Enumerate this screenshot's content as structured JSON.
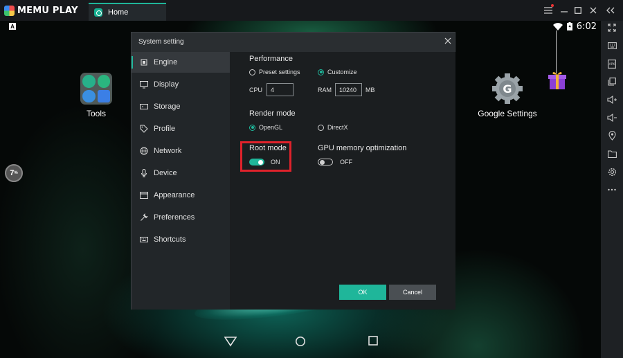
{
  "app": {
    "brand": "MEMU PLAY",
    "accent_color": "#1fb69a"
  },
  "tabs": [
    {
      "label": "Home",
      "icon": "home-app-icon"
    }
  ],
  "window_controls": [
    "menu-icon",
    "minimize-icon",
    "maximize-icon",
    "close-icon",
    "collapse-sidebar-icon"
  ],
  "right_sidebar": {
    "icons": [
      "fullscreen-icon",
      "keyboard-icon",
      "apk-icon",
      "multi-window-icon",
      "volume-up-icon",
      "volume-down-icon",
      "location-icon",
      "folder-icon",
      "settings-icon",
      "more-icon"
    ],
    "apk_text": "APK"
  },
  "android": {
    "status": {
      "time": "6:02",
      "notification_letter": "A"
    },
    "desktop": [
      {
        "label": "Tools",
        "icon": "tools-folder-icon"
      },
      {
        "label": "Google Settings",
        "icon": "google-settings-gear-icon"
      }
    ],
    "progress_badge": {
      "value": "7",
      "unit": "%"
    },
    "navbar": [
      "back-icon",
      "home-icon",
      "recents-icon"
    ]
  },
  "dialog": {
    "title": "System setting",
    "nav": [
      {
        "label": "Engine",
        "icon": "chip-icon",
        "active": true
      },
      {
        "label": "Display",
        "icon": "monitor-icon"
      },
      {
        "label": "Storage",
        "icon": "storage-icon"
      },
      {
        "label": "Profile",
        "icon": "tag-icon"
      },
      {
        "label": "Network",
        "icon": "globe-icon"
      },
      {
        "label": "Device",
        "icon": "microphone-icon"
      },
      {
        "label": "Appearance",
        "icon": "window-icon"
      },
      {
        "label": "Preferences",
        "icon": "wrench-icon"
      },
      {
        "label": "Shortcuts",
        "icon": "keyboard-icon"
      }
    ],
    "performance": {
      "label": "Performance",
      "options": [
        {
          "label": "Preset settings",
          "selected": false
        },
        {
          "label": "Customize",
          "selected": true
        }
      ],
      "cpu_label": "CPU",
      "cpu_value": "4",
      "ram_label": "RAM",
      "ram_value": "10240",
      "ram_unit": "MB"
    },
    "render_mode": {
      "label": "Render mode",
      "options": [
        {
          "label": "OpenGL",
          "selected": true
        },
        {
          "label": "DirectX",
          "selected": false
        }
      ]
    },
    "root_mode": {
      "label": "Root mode",
      "state": "ON"
    },
    "gpu_memory": {
      "label": "GPU memory optimization",
      "state": "OFF"
    },
    "buttons": {
      "ok": "OK",
      "cancel": "Cancel"
    }
  }
}
